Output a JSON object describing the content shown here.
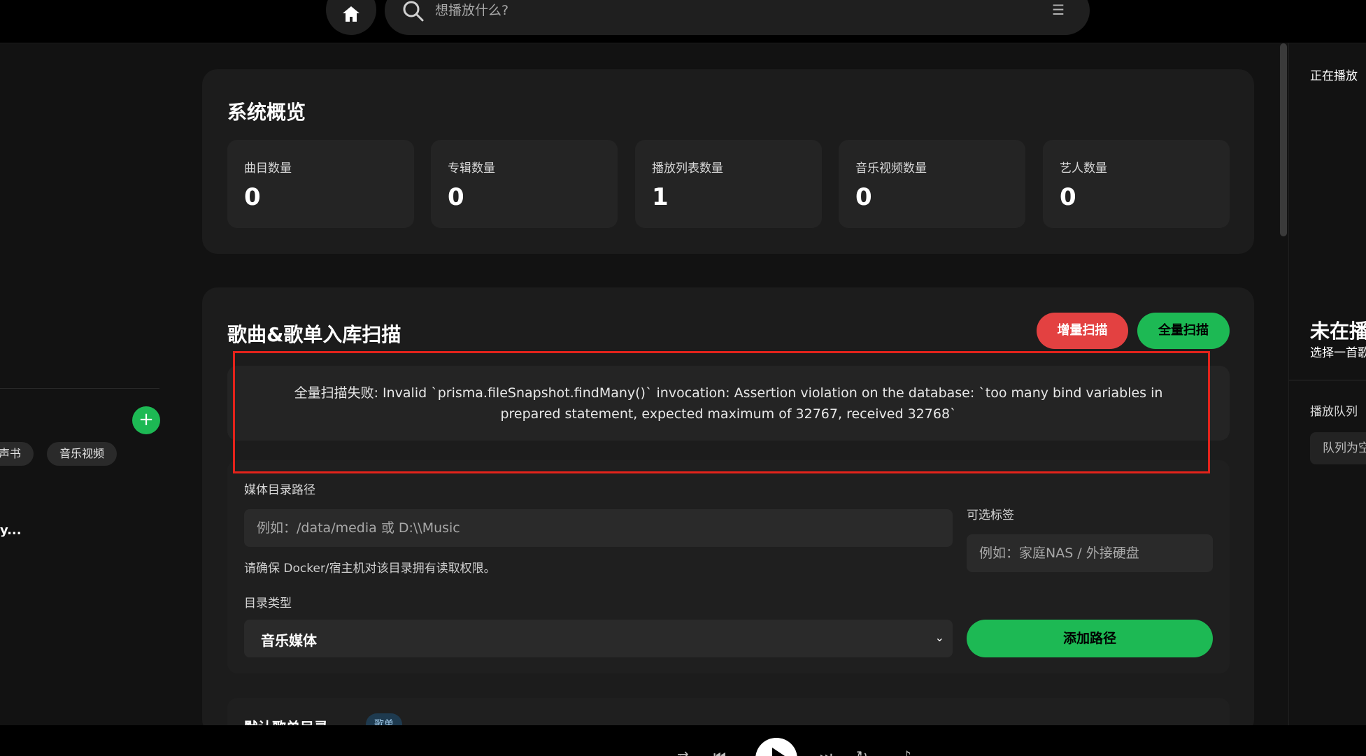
{
  "search": {
    "placeholder": "想播放什么?"
  },
  "left": {
    "chips": [
      "声书",
      "音乐视频"
    ],
    "truncated_item": "y...",
    "add_icon": "plus-icon"
  },
  "overview": {
    "title": "系统概览",
    "stats": [
      {
        "label": "曲目数量",
        "value": "0"
      },
      {
        "label": "专辑数量",
        "value": "0"
      },
      {
        "label": "播放列表数量",
        "value": "1"
      },
      {
        "label": "音乐视频数量",
        "value": "0"
      },
      {
        "label": "艺人数量",
        "value": "0"
      }
    ]
  },
  "scan": {
    "title": "歌曲&歌单入库扫描",
    "incremental_label": "增量扫描",
    "full_label": "全量扫描",
    "error_message": "全量扫描失败: Invalid `prisma.fileSnapshot.findMany()` invocation: Assertion violation on the database: `too many bind variables in prepared statement, expected maximum of 32767, received 32768`",
    "form": {
      "path_label": "媒体目录路径",
      "path_placeholder": "例如：/data/media 或 D:\\\\Music",
      "path_hint": "请确保 Docker/宿主机对该目录拥有读取权限。",
      "tag_label": "可选标签",
      "tag_placeholder": "例如：家庭NAS / 外接硬盘",
      "type_label": "目录类型",
      "type_value": "音乐媒体",
      "add_label": "添加路径"
    },
    "default_dir": {
      "title": "默认歌单目录",
      "badge": "歌单"
    }
  },
  "right": {
    "now_playing": "正在播放",
    "not_playing": "未在播",
    "select_hint": "选择一首歌",
    "queue_label": "播放队列",
    "queue_empty": "队列为空"
  },
  "colors": {
    "accent": "#1db954",
    "danger": "#e34141",
    "highlight": "#e3231b"
  }
}
